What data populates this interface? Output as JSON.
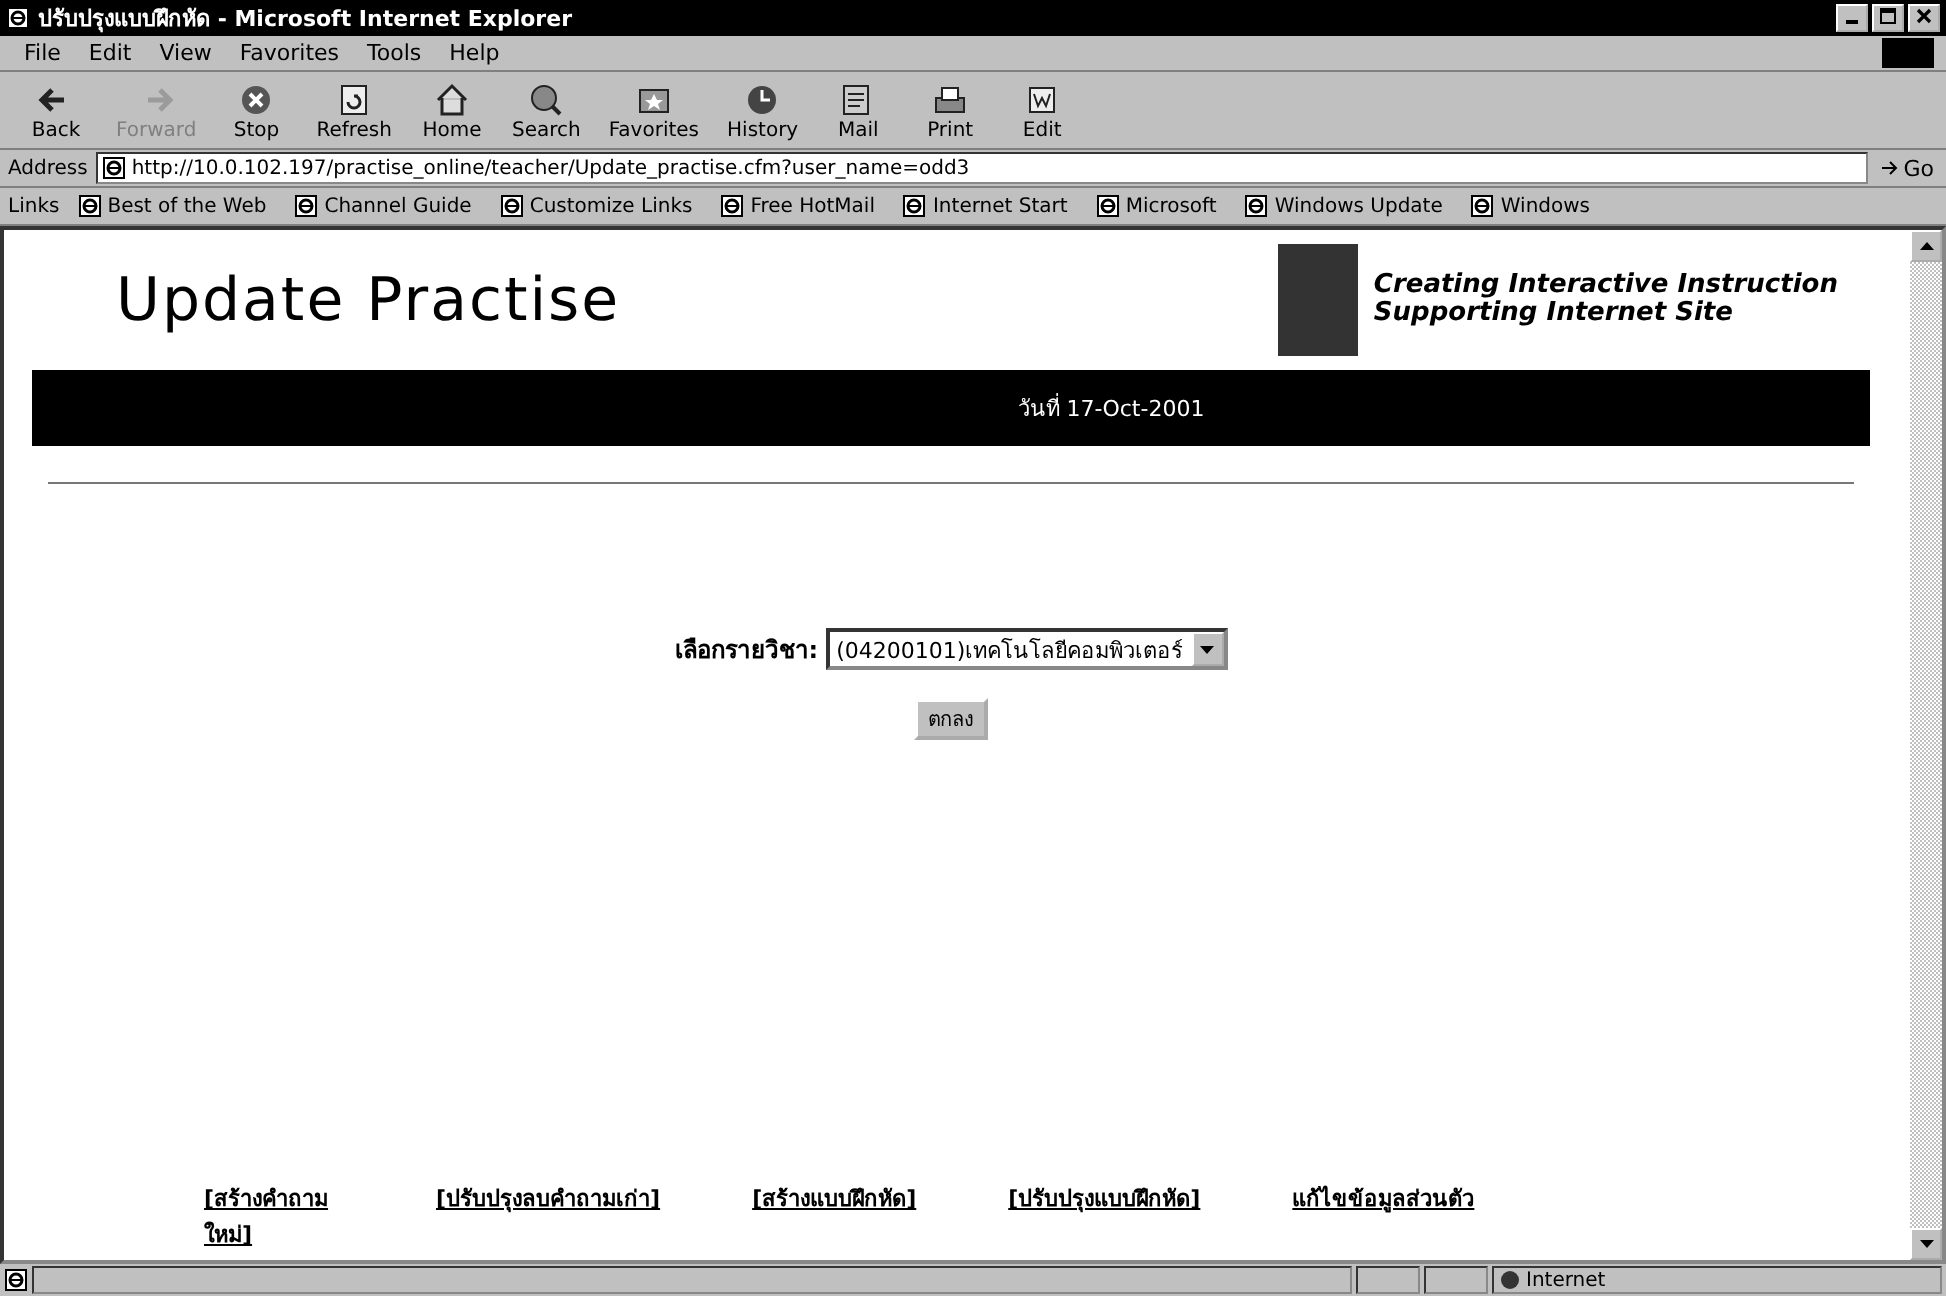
{
  "window": {
    "title": "ปรับปรุงแบบฝึกหัด - Microsoft Internet Explorer"
  },
  "menu": [
    "File",
    "Edit",
    "View",
    "Favorites",
    "Tools",
    "Help"
  ],
  "toolbar": [
    {
      "label": "Back",
      "kind": "back",
      "disabled": false
    },
    {
      "label": "Forward",
      "kind": "forward",
      "disabled": true
    },
    {
      "label": "Stop",
      "kind": "stop",
      "disabled": false
    },
    {
      "label": "Refresh",
      "kind": "refresh",
      "disabled": false
    },
    {
      "label": "Home",
      "kind": "home",
      "disabled": false
    },
    {
      "label": "Search",
      "kind": "search",
      "disabled": false
    },
    {
      "label": "Favorites",
      "kind": "favorites",
      "disabled": false
    },
    {
      "label": "History",
      "kind": "history",
      "disabled": false
    },
    {
      "label": "Mail",
      "kind": "mail",
      "disabled": false
    },
    {
      "label": "Print",
      "kind": "print",
      "disabled": false
    },
    {
      "label": "Edit",
      "kind": "edit",
      "disabled": false
    }
  ],
  "address": {
    "label": "Address",
    "value": "http://10.0.102.197/practise_online/teacher/Update_practise.cfm?user_name=odd3",
    "go": "Go"
  },
  "links": {
    "label": "Links",
    "items": [
      "Best of the Web",
      "Channel Guide",
      "Customize Links",
      "Free HotMail",
      "Internet Start",
      "Microsoft",
      "Windows Update",
      "Windows"
    ]
  },
  "page": {
    "heading": "Update Practise",
    "banner": [
      "Creating Interactive Instruction",
      "Supporting Internet Site"
    ],
    "date": "วันที่ 17-Oct-2001",
    "course": {
      "label": "เลือกรายวิชา:",
      "value": "(04200101)เทคโนโลยีคอมพิวเตอร์"
    },
    "submit": "ตกลง",
    "nav": [
      "[สร้างคำถาม ใหม่]",
      "[ปรับปรุงลบคำถามเก่า]",
      "[สร้างแบบฝึกหัด]",
      "[ปรับปรุงแบบฝึกหัด]",
      "แก้ไขข้อมูลส่วนตัว"
    ]
  },
  "status_bar": {
    "zone": "Internet"
  }
}
